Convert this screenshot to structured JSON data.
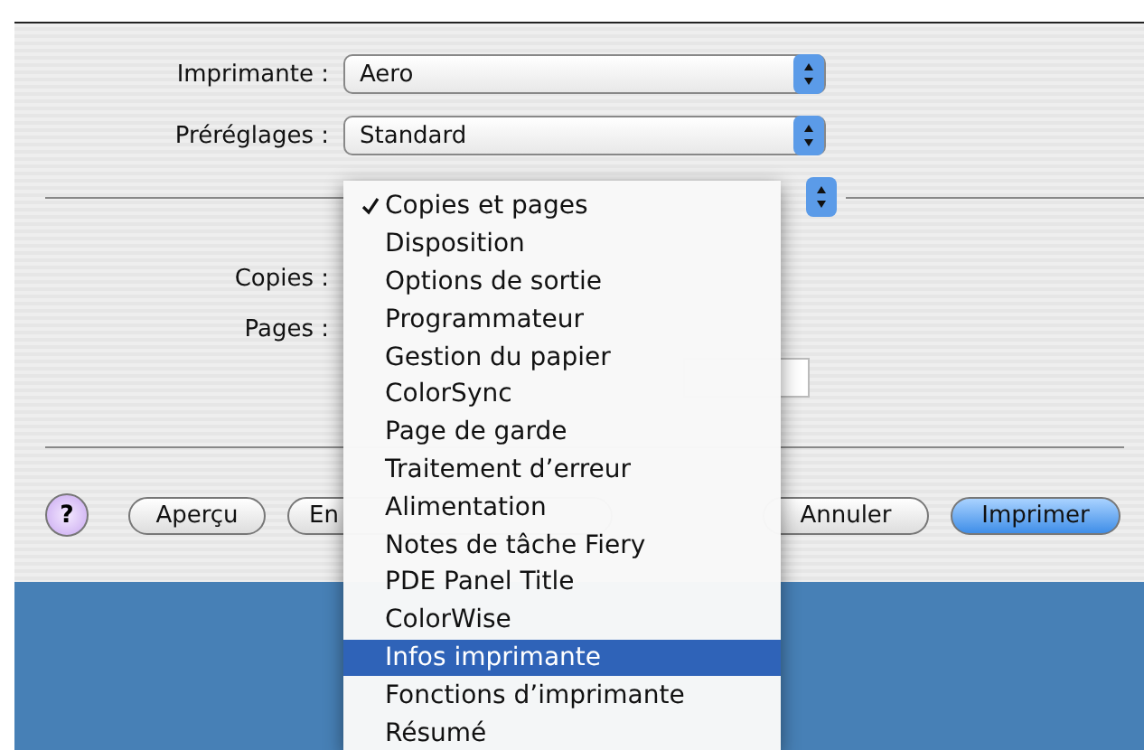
{
  "printer": {
    "label": "Imprimante :",
    "value": "Aero"
  },
  "presets": {
    "label": "Préréglages :",
    "value": "Standard"
  },
  "copies": {
    "label": "Copies :"
  },
  "pages": {
    "label": "Pages :"
  },
  "buttons": [
    {
      "label": "?",
      "kind": "help"
    },
    {
      "label": "Aperçu",
      "kind": "normal"
    },
    {
      "label": "En",
      "kind": "covered"
    },
    {
      "label": "Annuler",
      "kind": "normal"
    },
    {
      "label": "Imprimer",
      "kind": "default"
    }
  ],
  "menu": {
    "items": [
      {
        "label": "Copies et pages",
        "checked": true,
        "selected": false
      },
      {
        "label": "Disposition",
        "checked": false,
        "selected": false
      },
      {
        "label": "Options de sortie",
        "checked": false,
        "selected": false
      },
      {
        "label": "Programmateur",
        "checked": false,
        "selected": false
      },
      {
        "label": "Gestion du papier",
        "checked": false,
        "selected": false
      },
      {
        "label": "ColorSync",
        "checked": false,
        "selected": false
      },
      {
        "label": "Page de garde",
        "checked": false,
        "selected": false
      },
      {
        "label": "Traitement d’erreur",
        "checked": false,
        "selected": false
      },
      {
        "label": "Alimentation",
        "checked": false,
        "selected": false
      },
      {
        "label": "Notes de tâche Fiery",
        "checked": false,
        "selected": false
      },
      {
        "label": "PDE Panel Title",
        "checked": false,
        "selected": false
      },
      {
        "label": "ColorWise",
        "checked": false,
        "selected": false
      },
      {
        "label": "Infos imprimante",
        "checked": false,
        "selected": true
      },
      {
        "label": "Fonctions d’imprimante",
        "checked": false,
        "selected": false
      },
      {
        "label": "Résumé",
        "checked": false,
        "selected": false
      }
    ]
  }
}
